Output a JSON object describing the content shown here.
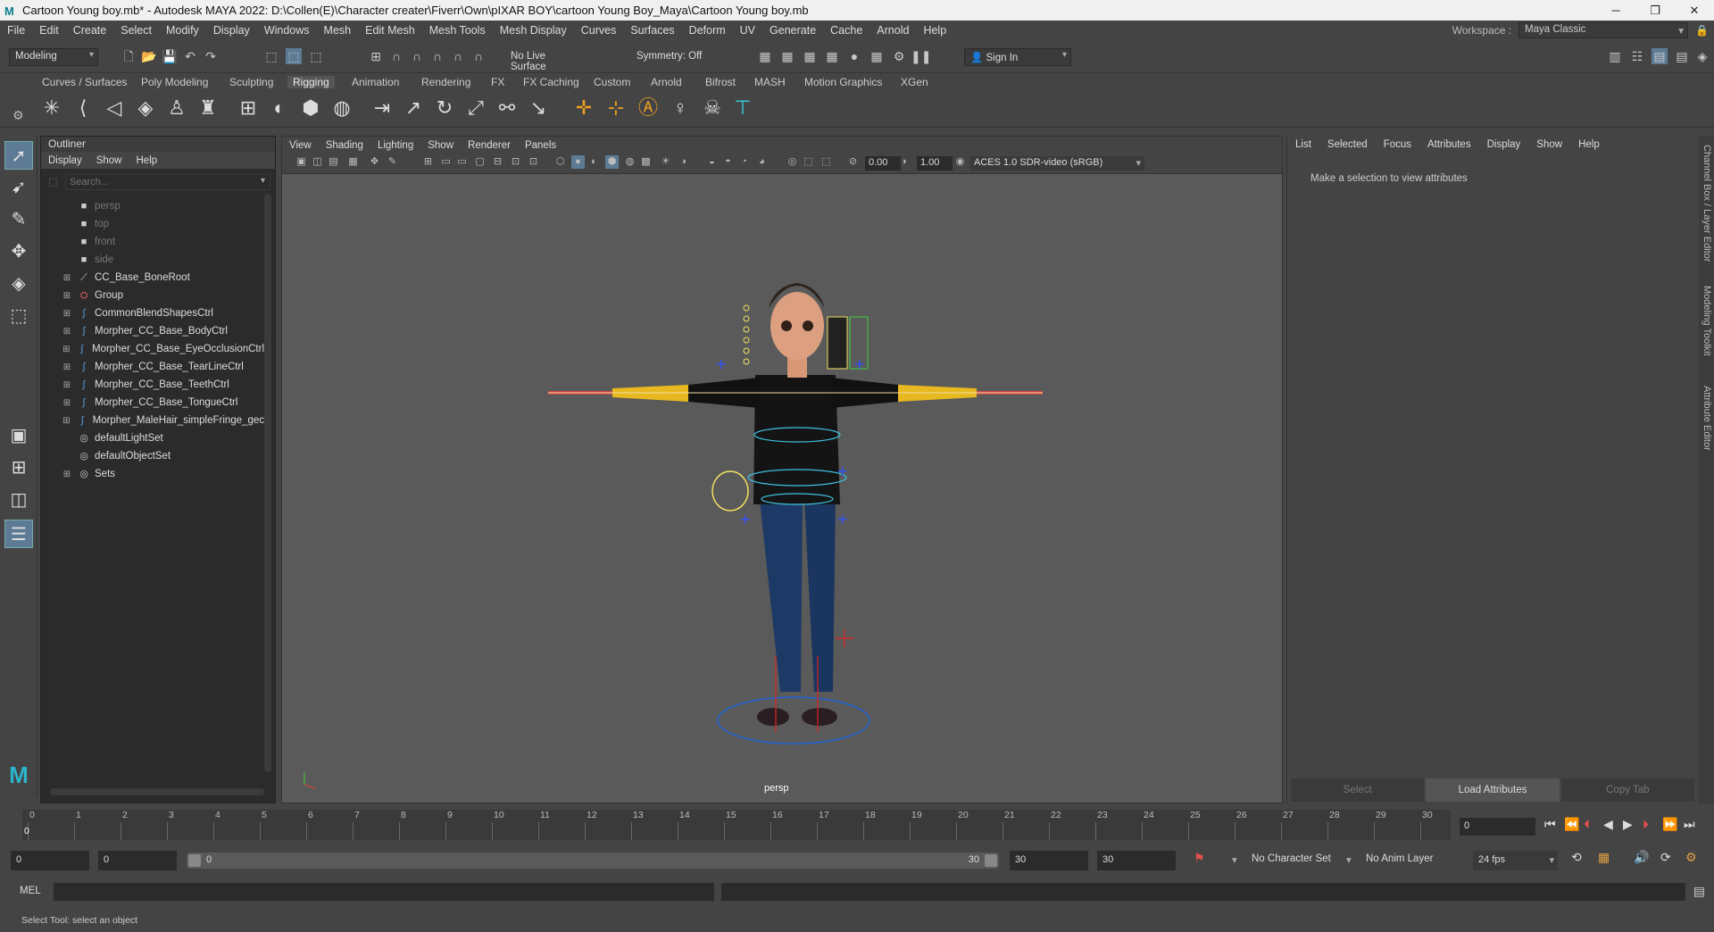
{
  "window": {
    "title": "Cartoon Young boy.mb* - Autodesk MAYA 2022: D:\\Collen(E)\\Character creater\\Fiverr\\Own\\pIXAR BOY\\cartoon Young Boy_Maya\\Cartoon Young boy.mb"
  },
  "menubar": [
    "File",
    "Edit",
    "Create",
    "Select",
    "Modify",
    "Display",
    "Windows",
    "Mesh",
    "Edit Mesh",
    "Mesh Tools",
    "Mesh Display",
    "Curves",
    "Surfaces",
    "Deform",
    "UV",
    "Generate",
    "Cache",
    "Arnold",
    "Help"
  ],
  "workspace": {
    "label": "Workspace :",
    "value": "Maya Classic"
  },
  "status": {
    "mode": "Modeling",
    "live_surface": "No Live Surface",
    "symmetry": "Symmetry: Off",
    "sign_in": "Sign In"
  },
  "shelf_tabs": [
    "Curves / Surfaces",
    "Poly Modeling",
    "Sculpting",
    "Rigging",
    "Animation",
    "Rendering",
    "FX",
    "FX Caching",
    "Custom",
    "Arnold",
    "Bifrost",
    "MASH",
    "Motion Graphics",
    "XGen"
  ],
  "shelf_active": "Rigging",
  "outliner": {
    "title": "Outliner",
    "menu": [
      "Display",
      "Show",
      "Help"
    ],
    "search_placeholder": "Search...",
    "items": [
      {
        "name": "persp",
        "icon": "camera-icon",
        "expandable": false,
        "dim": true
      },
      {
        "name": "top",
        "icon": "camera-icon",
        "expandable": false,
        "dim": true
      },
      {
        "name": "front",
        "icon": "camera-icon",
        "expandable": false,
        "dim": true
      },
      {
        "name": "side",
        "icon": "camera-icon",
        "expandable": false,
        "dim": true
      },
      {
        "name": "CC_Base_BoneRoot",
        "icon": "joint-icon",
        "expandable": true,
        "dim": false
      },
      {
        "name": "Group",
        "icon": "group-icon",
        "expandable": true,
        "dim": false
      },
      {
        "name": "CommonBlendShapesCtrl",
        "icon": "curve-icon",
        "expandable": true,
        "dim": false
      },
      {
        "name": "Morpher_CC_Base_BodyCtrl",
        "icon": "curve-icon",
        "expandable": true,
        "dim": false
      },
      {
        "name": "Morpher_CC_Base_EyeOcclusionCtrl",
        "icon": "curve-icon",
        "expandable": true,
        "dim": false
      },
      {
        "name": "Morpher_CC_Base_TearLineCtrl",
        "icon": "curve-icon",
        "expandable": true,
        "dim": false
      },
      {
        "name": "Morpher_CC_Base_TeethCtrl",
        "icon": "curve-icon",
        "expandable": true,
        "dim": false
      },
      {
        "name": "Morpher_CC_Base_TongueCtrl",
        "icon": "curve-icon",
        "expandable": true,
        "dim": false
      },
      {
        "name": "Morpher_MaleHair_simpleFringe_gec",
        "icon": "curve-icon",
        "expandable": true,
        "dim": false
      },
      {
        "name": "defaultLightSet",
        "icon": "set-icon",
        "expandable": false,
        "dim": false
      },
      {
        "name": "defaultObjectSet",
        "icon": "set-icon",
        "expandable": false,
        "dim": false
      },
      {
        "name": "Sets",
        "icon": "set-icon",
        "expandable": true,
        "dim": false
      }
    ]
  },
  "viewport": {
    "menu": [
      "View",
      "Shading",
      "Lighting",
      "Show",
      "Renderer",
      "Panels"
    ],
    "near": "0.00",
    "far": "1.00",
    "color_space": "ACES 1.0 SDR-video (sRGB)",
    "camera": "persp"
  },
  "attribute_editor": {
    "menu": [
      "List",
      "Selected",
      "Focus",
      "Attributes",
      "Display",
      "Show",
      "Help"
    ],
    "message": "Make a selection to view attributes",
    "buttons": [
      "Select",
      "Load Attributes",
      "Copy Tab"
    ]
  },
  "side_tabs": [
    "Channel Box / Layer Editor",
    "Modeling Toolkit",
    "Attribute Editor"
  ],
  "timeline": {
    "ticks": [
      "0",
      "1",
      "2",
      "3",
      "4",
      "5",
      "6",
      "7",
      "8",
      "9",
      "10",
      "11",
      "12",
      "13",
      "14",
      "15",
      "16",
      "17",
      "18",
      "19",
      "20",
      "21",
      "22",
      "23",
      "24",
      "25",
      "26",
      "27",
      "28",
      "29",
      "30"
    ],
    "current_frame": "0",
    "current_time_field": "0"
  },
  "range": {
    "start": "0",
    "anim_start": "0",
    "slider_start": "0",
    "slider_end": "30",
    "end": "30",
    "anim_end": "30",
    "character_set": "No Character Set",
    "anim_layer": "No Anim Layer",
    "fps": "24 fps"
  },
  "command": {
    "label": "MEL"
  },
  "help_line": "Select Tool: select an object",
  "colors": {
    "accent": "#5d7b95",
    "panel": "#444444",
    "dark": "#2b2b2b",
    "viewport": "#5a5a5a",
    "yellow": "#f0b400"
  }
}
